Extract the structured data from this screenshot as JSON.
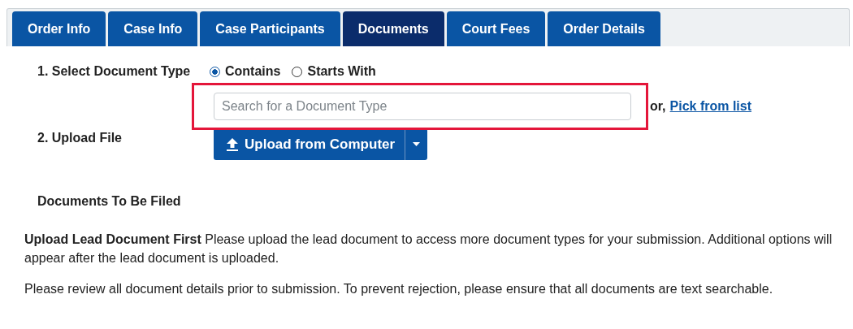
{
  "tabs": [
    {
      "label": "Order Info",
      "selected": false
    },
    {
      "label": "Case Info",
      "selected": false
    },
    {
      "label": "Case Participants",
      "selected": false
    },
    {
      "label": "Documents",
      "selected": true
    },
    {
      "label": "Court Fees",
      "selected": false
    },
    {
      "label": "Order Details",
      "selected": false
    }
  ],
  "document_type": {
    "label": "1. Select Document Type",
    "options": [
      {
        "label": "Contains",
        "selected": true
      },
      {
        "label": "Starts With",
        "selected": false
      }
    ],
    "search": {
      "placeholder": "Search for a Document Type"
    },
    "or_text": "or,",
    "link": "Pick from list"
  },
  "upload": {
    "label": "2. Upload File",
    "button": "Upload from Computer"
  },
  "section_title": "Documents To Be Filed",
  "paragraphs": [
    "**Upload Lead Document First** Please upload the lead document to access more document types for your submission. Additional options will appear after the lead document is uploaded.",
    "Please review all document details prior to submission. To prevent rejection, please ensure that all documents are text searchable."
  ]
}
